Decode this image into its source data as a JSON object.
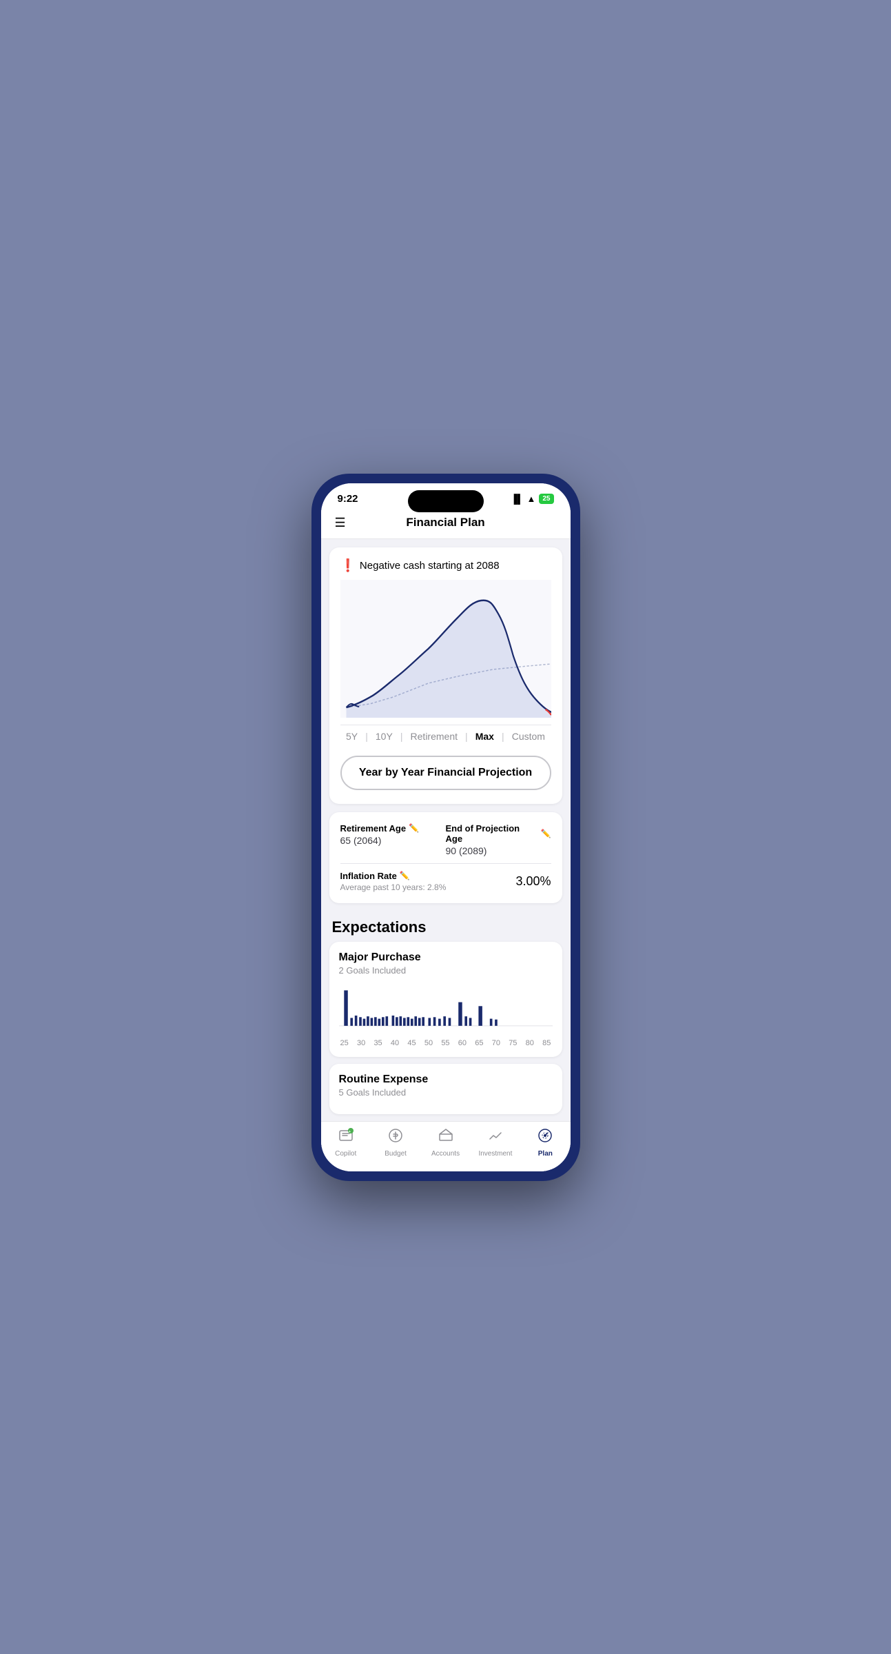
{
  "statusBar": {
    "time": "9:22",
    "battery": "25"
  },
  "header": {
    "title": "Financial Plan"
  },
  "chart": {
    "alertIcon": "!",
    "alertText": "Negative cash starting at 2088"
  },
  "timeRanges": [
    {
      "label": "5Y",
      "active": false
    },
    {
      "label": "10Y",
      "active": false
    },
    {
      "label": "Retirement",
      "active": false
    },
    {
      "label": "Max",
      "active": true
    },
    {
      "label": "Custom",
      "active": false
    }
  ],
  "projectionButton": {
    "label": "Year by Year Financial Projection"
  },
  "settings": {
    "retirementAge": {
      "label": "Retirement Age",
      "value": "65 (2064)"
    },
    "endOfProjectionAge": {
      "label": "End of Projection Age",
      "value": "90 (2089)"
    },
    "inflationRate": {
      "label": "Inflation Rate",
      "subLabel": "Average past 10 years: 2.8%",
      "value": "3.00%"
    }
  },
  "expectations": {
    "sectionTitle": "Expectations",
    "majorPurchase": {
      "title": "Major Purchase",
      "subLabel": "2 Goals Included"
    },
    "routineExpense": {
      "title": "Routine Expense",
      "subLabel": "5 Goals Included"
    }
  },
  "barChart": {
    "xLabels": [
      "25",
      "30",
      "35",
      "40",
      "45",
      "50",
      "55",
      "60",
      "65",
      "70",
      "75",
      "80",
      "85"
    ]
  },
  "bottomNav": [
    {
      "label": "Copilot",
      "icon": "📊",
      "active": false
    },
    {
      "label": "Budget",
      "icon": "💰",
      "active": false
    },
    {
      "label": "Accounts",
      "icon": "🏛",
      "active": false
    },
    {
      "label": "Investment",
      "icon": "📈",
      "active": false
    },
    {
      "label": "Plan",
      "icon": "⏱",
      "active": true
    }
  ]
}
